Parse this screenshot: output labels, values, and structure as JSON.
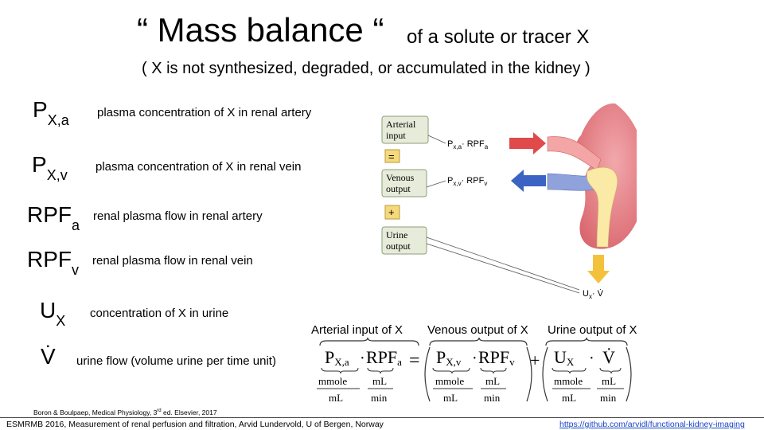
{
  "title": {
    "main": "“ Mass balance “",
    "sub": "of a solute or tracer X"
  },
  "subtitle": "( X is not synthesized, degraded, or accumulated in the kidney )",
  "definitions": [
    {
      "base": "P",
      "sub": "X,a",
      "text": "plasma concentration of X in renal artery"
    },
    {
      "base": "P",
      "sub": "X,v",
      "text": "plasma concentration of X in renal vein"
    },
    {
      "base": "RPF",
      "sub": "a",
      "text": "renal plasma flow in renal artery"
    },
    {
      "base": "RPF",
      "sub": "v",
      "text": "renal plasma flow in renal vein"
    },
    {
      "base": "U",
      "sub": "X",
      "text": "concentration of X in urine"
    },
    {
      "base": "V̇",
      "sub": "",
      "text": "urine flow  (volume urine per time unit)"
    }
  ],
  "diagram": {
    "boxes": {
      "arterial": [
        "Arterial",
        "input"
      ],
      "venous": [
        "Venous",
        "output"
      ],
      "urine": [
        "Urine",
        "output"
      ],
      "equals": "=",
      "plus": "+"
    },
    "labels": {
      "arterial_p": "P",
      "arterial_p_sub": "x,a",
      "arterial_rpf": "· RPF",
      "arterial_rpf_sub": "a",
      "venous_p": "P",
      "venous_p_sub": "x,v",
      "venous_rpf": "· RPF",
      "venous_rpf_sub": "v",
      "urine_u": "U",
      "urine_u_sub": "x",
      "urine_v": "· V̇"
    },
    "colors": {
      "kidney": "#e8828a",
      "artery": "#f4a5a5",
      "vein": "#8fa2dc",
      "ureter": "#fbe9a6",
      "arrow_red": "#e04a4a",
      "arrow_blue": "#3b63c4",
      "arrow_yellow": "#f4c23a",
      "box_fill": "#e6ecd9",
      "box_border": "#8c9e7a",
      "op_fill": "#f6d97a"
    }
  },
  "equation": {
    "labels": {
      "arterial": "Arterial input of X",
      "venous": "Venous output of X",
      "urine": "Urine output of X"
    },
    "terms": {
      "pxa": "P",
      "pxa_sub": "X,a",
      "rpfa": "RPF",
      "rpfa_sub": "a",
      "pxv": "P",
      "pxv_sub": "X,v",
      "rpfv": "RPF",
      "rpfv_sub": "v",
      "ux": "U",
      "ux_sub": "X",
      "v": "V̇"
    },
    "ops": {
      "dot": "·",
      "equals": "=",
      "plus": "+"
    },
    "units": {
      "mmole": "mmole",
      "ml": "mL",
      "min": "min"
    }
  },
  "citation": {
    "text": "Boron & Boulpaep, Medical Physiology, 3",
    "sup": "rd",
    "rest": " ed. Elsevier, 2017"
  },
  "footer": {
    "left": "ESMRMB 2016, Measurement of renal perfusion and filtration,  Arvid Lundervold, U of Bergen, Norway",
    "right": "https://github.com/arvidl/functional-kidney-imaging"
  }
}
